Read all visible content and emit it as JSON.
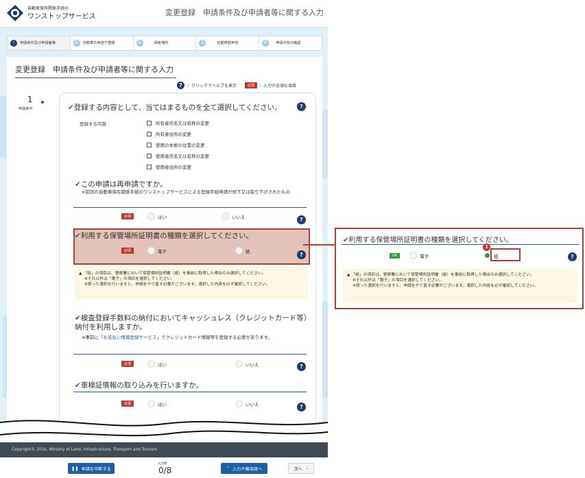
{
  "header": {
    "logo_small": "自動車保有関係手続の",
    "logo_big": "ワンストップサービス",
    "title": "変更登録　申請条件及び申請者等に関する入力"
  },
  "steps": [
    {
      "num": "!",
      "label": "申請条件及び申請者等"
    },
    {
      "num": "未",
      "label": "自動車の用途や登録"
    },
    {
      "num": "未",
      "label": "保管場所"
    },
    {
      "num": "未",
      "label": "自動車税申告"
    },
    {
      "num": "未",
      "label": "申請内容の確認"
    }
  ],
  "panel": {
    "title": "変更登録　申請条件及び申請者等に関する入力",
    "legend_help": "：クリックでヘルプを表示",
    "legend_required": "：入力が必須な項目",
    "required_tag": "必須",
    "ok_tag": "OK",
    "step_number": "1",
    "step_label": "申請条件"
  },
  "q1": {
    "title": "登録する内容として、当てはまるものを全て選択してください。",
    "field_label": "登録する内容",
    "options": [
      "所有者氏名又は名称の変更",
      "所有者住所の変更",
      "使用の本拠の位置の変更",
      "使用者氏名又は名称の変更",
      "使用者住所の変更"
    ]
  },
  "q2": {
    "title": "この申請は再申請ですか。",
    "note": "※前回の自動車保有関係手続のワンストップサービスによる登録手続申請が却下又は取り下げされたもの",
    "yes": "はい",
    "no": "いいえ"
  },
  "q3": {
    "title": "利用する保管場所証明書の種類を選択してください。",
    "opt_electronic": "電子",
    "opt_paper": "紙",
    "warning_1": "「紙」の項目は、警察署において保管場所証明書（紙）を事前に取得した場合のみ選択してください。",
    "warning_2": "※それ以外は「電子」の項目を選択してください。",
    "warning_3": "※誤った選択を行いますと、申請をやり直す必要がございます。選択した内容を必ず確認してください。"
  },
  "q4": {
    "title": "検査登録手数料の納付においてキャッシュレス（クレジットカード等）納付を利用しますか。",
    "note_pre": "※事前に「",
    "note_link": "お支払い情報登録サービス",
    "note_post": "」でクレジットカード情報等を登録する必要があります。",
    "yes": "はい",
    "no": "いいえ"
  },
  "q5": {
    "title": "車検証情報の取り込みを行いますか。",
    "yes": "はい",
    "no": "いいえ"
  },
  "footer": {
    "copyright": "Copyright© 2016, Ministry of Land, Infrastructure, Transport and Tourism"
  },
  "bottombar": {
    "suspend": "申請を中断する",
    "counter_label": "入力残",
    "counter": "0/8",
    "unfilled": "入力不備項目へ",
    "next": "次へ"
  },
  "zoom": {
    "annotation_number": "1"
  },
  "colors": {
    "accent": "#1a5fa8",
    "required": "#c0392b",
    "ok": "#2e9e3f",
    "highlight": "#b04132"
  }
}
